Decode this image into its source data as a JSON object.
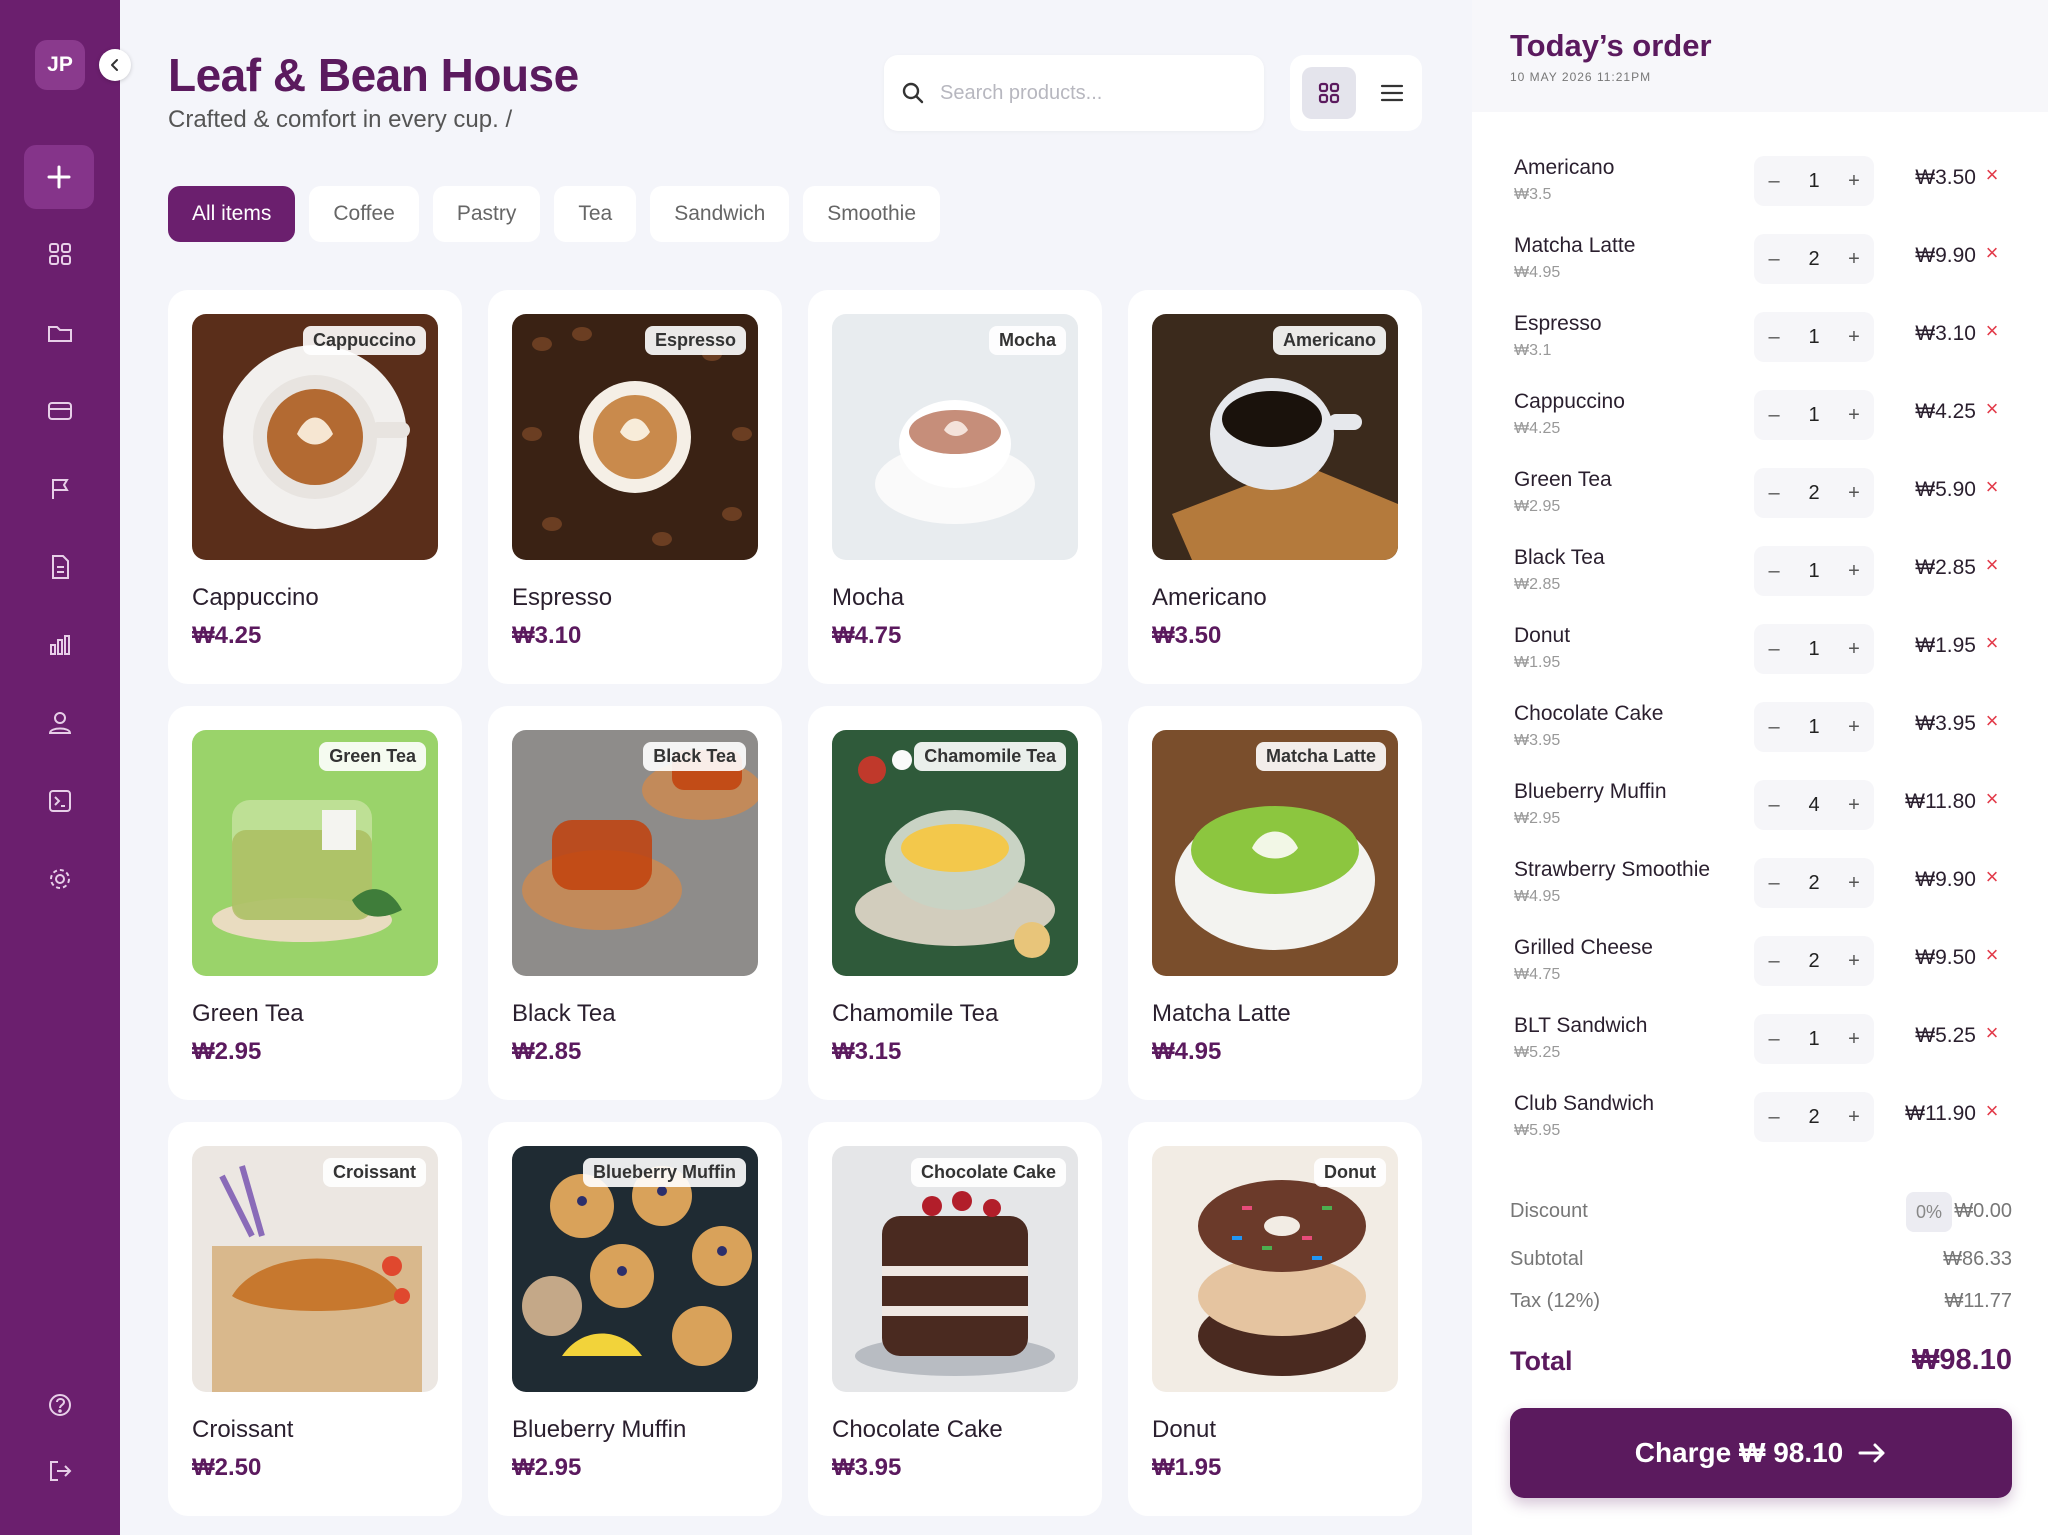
{
  "user": {
    "initials": "JP"
  },
  "header": {
    "title": "Leaf & Bean House",
    "subtitle": "Crafted & comfort in every cup. /",
    "search_placeholder": "Search products..."
  },
  "tabs": [
    "All items",
    "Coffee",
    "Pastry",
    "Tea",
    "Sandwich",
    "Smoothie"
  ],
  "active_tab": "All items",
  "products": [
    {
      "name": "Cappuccino",
      "price": "₩4.25",
      "badge": "Cappuccino",
      "art": "cappuccino"
    },
    {
      "name": "Espresso",
      "price": "₩3.10",
      "badge": "Espresso",
      "art": "espresso"
    },
    {
      "name": "Mocha",
      "price": "₩4.75",
      "badge": "Mocha",
      "art": "mocha"
    },
    {
      "name": "Americano",
      "price": "₩3.50",
      "badge": "Americano",
      "art": "americano"
    },
    {
      "name": "Green Tea",
      "price": "₩2.95",
      "badge": "Green Tea",
      "art": "greentea"
    },
    {
      "name": "Black Tea",
      "price": "₩2.85",
      "badge": "Black Tea",
      "art": "blacktea"
    },
    {
      "name": "Chamomile Tea",
      "price": "₩3.15",
      "badge": "Chamomile Tea",
      "art": "chamomile"
    },
    {
      "name": "Matcha Latte",
      "price": "₩4.95",
      "badge": "Matcha Latte",
      "art": "matcha"
    },
    {
      "name": "Croissant",
      "price": "₩2.50",
      "badge": "Croissant",
      "art": "croissant"
    },
    {
      "name": "Blueberry Muffin",
      "price": "₩2.95",
      "badge": "Blueberry Muffin",
      "art": "muffin"
    },
    {
      "name": "Chocolate Cake",
      "price": "₩3.95",
      "badge": "Chocolate Cake",
      "art": "cake"
    },
    {
      "name": "Donut",
      "price": "₩1.95",
      "badge": "Donut",
      "art": "donut"
    }
  ],
  "order": {
    "title": "Today’s order",
    "date": "10 MAY 2026 11:21PM",
    "items": [
      {
        "name": "Americano",
        "unit": "₩3.5",
        "qty": "1",
        "total": "₩3.50"
      },
      {
        "name": "Matcha Latte",
        "unit": "₩4.95",
        "qty": "2",
        "total": "₩9.90"
      },
      {
        "name": "Espresso",
        "unit": "₩3.1",
        "qty": "1",
        "total": "₩3.10"
      },
      {
        "name": "Cappuccino",
        "unit": "₩4.25",
        "qty": "1",
        "total": "₩4.25"
      },
      {
        "name": "Green Tea",
        "unit": "₩2.95",
        "qty": "2",
        "total": "₩5.90"
      },
      {
        "name": "Black Tea",
        "unit": "₩2.85",
        "qty": "1",
        "total": "₩2.85"
      },
      {
        "name": "Donut",
        "unit": "₩1.95",
        "qty": "1",
        "total": "₩1.95"
      },
      {
        "name": "Chocolate Cake",
        "unit": "₩3.95",
        "qty": "1",
        "total": "₩3.95"
      },
      {
        "name": "Blueberry Muffin",
        "unit": "₩2.95",
        "qty": "4",
        "total": "₩11.80"
      },
      {
        "name": "Strawberry Smoothie",
        "unit": "₩4.95",
        "qty": "2",
        "total": "₩9.90"
      },
      {
        "name": "Grilled Cheese",
        "unit": "₩4.75",
        "qty": "2",
        "total": "₩9.50"
      },
      {
        "name": "BLT Sandwich",
        "unit": "₩5.25",
        "qty": "1",
        "total": "₩5.25"
      },
      {
        "name": "Club Sandwich",
        "unit": "₩5.95",
        "qty": "2",
        "total": "₩11.90"
      }
    ],
    "discount_label": "Discount",
    "discount_pct": "0%",
    "discount_value": "₩0.00",
    "subtotal_label": "Subtotal",
    "subtotal_value": "₩86.33",
    "tax_label": "Tax (12%)",
    "tax_value": "₩11.77",
    "total_label": "Total",
    "total_value": "₩98.10",
    "charge_label": "Charge ₩ 98.10"
  },
  "colors": {
    "brand": "#6b1f6e",
    "brand_dark": "#5b1a5e",
    "remove": "#e23b4a"
  },
  "sidebar_icons": [
    "grid-icon",
    "folder-icon",
    "card-icon",
    "flag-icon",
    "document-icon",
    "bar-chart-icon",
    "users-icon",
    "terminal-icon",
    "settings-icon",
    "help-icon",
    "logout-icon"
  ]
}
